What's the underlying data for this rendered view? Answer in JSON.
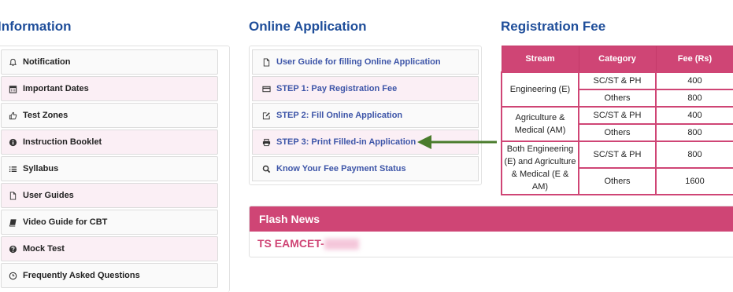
{
  "info": {
    "heading": "Information",
    "items": [
      {
        "label": "Notification",
        "icon": "bell-icon"
      },
      {
        "label": "Important Dates",
        "icon": "calendar-icon"
      },
      {
        "label": "Test Zones",
        "icon": "thumbs-up-icon"
      },
      {
        "label": "Instruction Booklet",
        "icon": "info-circle-icon"
      },
      {
        "label": "Syllabus",
        "icon": "list-icon"
      },
      {
        "label": "User Guides",
        "icon": "file-icon"
      },
      {
        "label": "Video Guide for CBT",
        "icon": "book-icon"
      },
      {
        "label": "Mock Test",
        "icon": "question-circle-icon"
      },
      {
        "label": "Frequently Asked Questions",
        "icon": "clock-icon"
      }
    ]
  },
  "online": {
    "heading": "Online Application",
    "items": [
      {
        "label": "User Guide for filling Online Application",
        "icon": "file-icon"
      },
      {
        "label": "STEP 1: Pay Registration Fee",
        "icon": "credit-card-icon"
      },
      {
        "label": "STEP 2: Fill Online Application",
        "icon": "edit-icon"
      },
      {
        "label": "STEP 3: Print Filled-in Application",
        "icon": "print-icon"
      },
      {
        "label": "Know Your Fee Payment Status",
        "icon": "search-icon"
      }
    ]
  },
  "fee": {
    "heading": "Registration Fee",
    "headers": [
      "Stream",
      "Category",
      "Fee (Rs)"
    ],
    "rows": [
      {
        "stream": "Engineering (E)",
        "entries": [
          {
            "category": "SC/ST & PH",
            "fee": "400"
          },
          {
            "category": "Others",
            "fee": "800"
          }
        ]
      },
      {
        "stream": "Agriculture & Medical (AM)",
        "entries": [
          {
            "category": "SC/ST & PH",
            "fee": "400"
          },
          {
            "category": "Others",
            "fee": "800"
          }
        ]
      },
      {
        "stream": "Both Engineering (E) and Agriculture & Medical (E & AM)",
        "entries": [
          {
            "category": "SC/ST & PH",
            "fee": "800"
          },
          {
            "category": "Others",
            "fee": "1600"
          }
        ]
      }
    ]
  },
  "flash": {
    "heading": "Flash News",
    "text": "TS EAMCET-"
  },
  "colors": {
    "accent": "#cf4575",
    "heading": "#1f4e9a",
    "link": "#3d55a8",
    "arrow": "#4a7c2c"
  }
}
